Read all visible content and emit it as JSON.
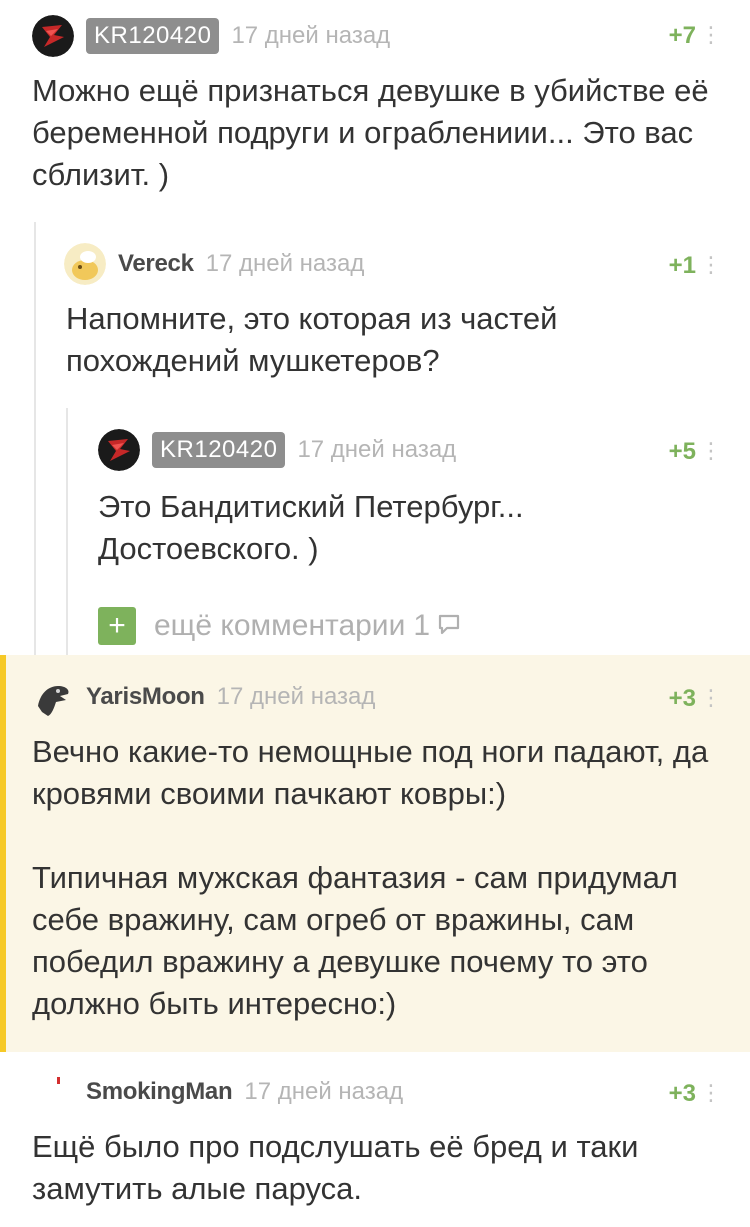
{
  "comments": [
    {
      "username": "KR120420",
      "time": "17 дней назад",
      "rating": "+7",
      "text": "Можно ещё признаться девушке в убийстве её беременной подруги и ограблениии... Это вас сблизит. )"
    },
    {
      "username": "Vereck",
      "time": "17 дней назад",
      "rating": "+1",
      "text": "Напомните, это которая из частей похождений мушкетеров?"
    },
    {
      "username": "KR120420",
      "time": "17 дней назад",
      "rating": "+5",
      "text": "Это Бандитиский Петербург... Достоевского. )"
    },
    {
      "username": "YarisMoon",
      "time": "17 дней назад",
      "rating": "+3",
      "text": "Вечно какие-то немощные под ноги падают, да кровями своими пачкают ковры:)\n\nТипичная мужская фантазия - сам придумал себе вражину, сам огреб от вражины, сам победил вражину а девушке почему то это должно быть интересно:)"
    },
    {
      "username": "SmokingMan",
      "time": "17 дней назад",
      "rating": "+3",
      "text": "Ещё было про подслушать её бред и таки замутить алые паруса."
    }
  ],
  "more_comments": {
    "plus": "+",
    "label": "ещё комментарии",
    "count": "1"
  },
  "menu_glyph": "⋮",
  "colors": {
    "rating": "#7eb25c",
    "highlight_bg": "#fbf6e6",
    "highlight_bar": "#f6c927",
    "badge_bg": "#8e8e8e"
  }
}
